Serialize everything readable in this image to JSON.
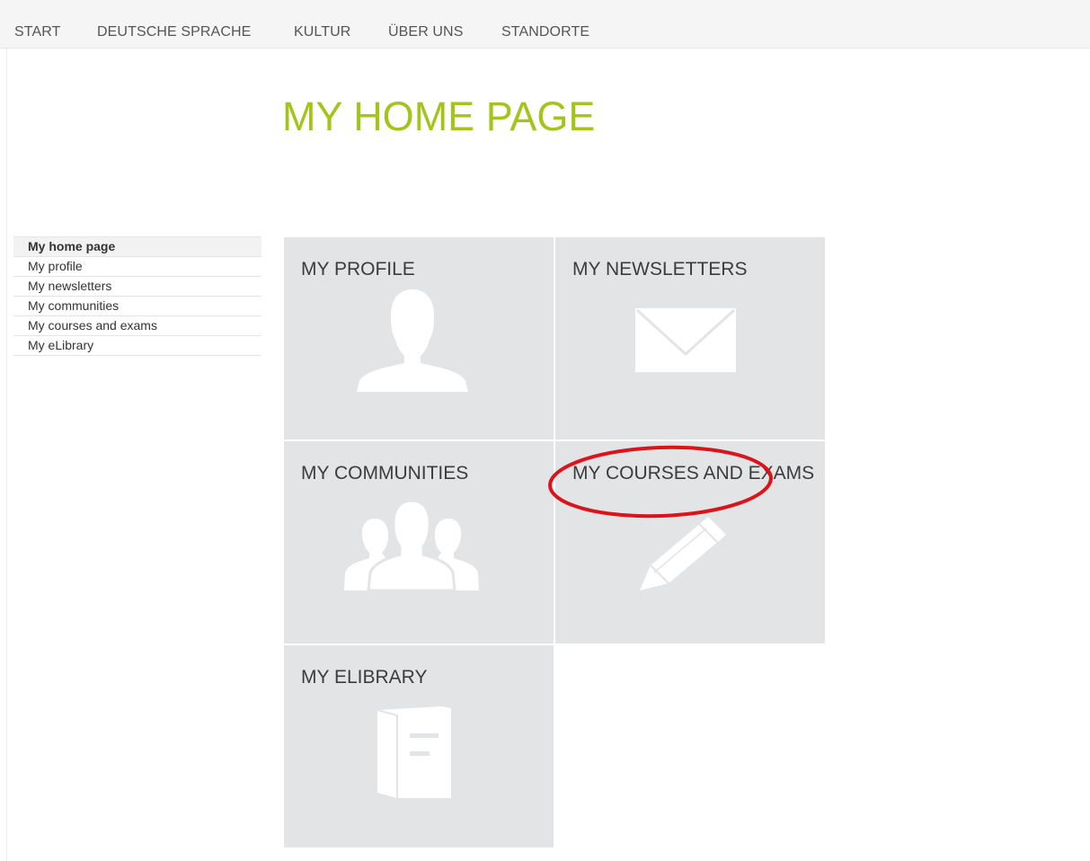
{
  "nav": {
    "items": [
      {
        "label": "START"
      },
      {
        "label": "DEUTSCHE SPRACHE"
      },
      {
        "label": "KULTUR"
      },
      {
        "label": "ÜBER UNS"
      },
      {
        "label": "STANDORTE"
      }
    ]
  },
  "page": {
    "title": "MY HOME PAGE"
  },
  "sidebar": {
    "items": [
      {
        "label": "My home page",
        "active": true
      },
      {
        "label": "My profile"
      },
      {
        "label": "My newsletters"
      },
      {
        "label": "My communities"
      },
      {
        "label": "My courses and exams"
      },
      {
        "label": "My eLibrary"
      }
    ]
  },
  "tiles": [
    {
      "title": "MY PROFILE",
      "icon": "person-icon"
    },
    {
      "title": "MY NEWSLETTERS",
      "icon": "envelope-icon"
    },
    {
      "title": "MY COMMUNITIES",
      "icon": "group-icon"
    },
    {
      "title": "MY COURSES AND EXAMS",
      "icon": "pencil-icon"
    },
    {
      "title": "MY ELIBRARY",
      "icon": "book-icon"
    }
  ],
  "colors": {
    "accent": "#a3c41a",
    "tile_background": "#e3e4e6",
    "annotation": "#d9141b"
  }
}
